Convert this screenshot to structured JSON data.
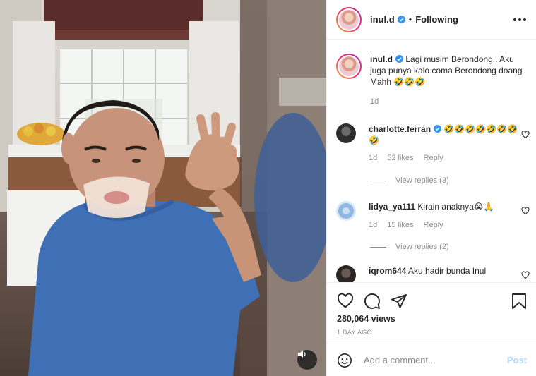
{
  "media": {
    "type": "video",
    "mute_icon": "speaker-icon"
  },
  "header": {
    "username": "inul.d",
    "separator": "•",
    "follow_state": "Following",
    "more_icon": "more-dots-icon"
  },
  "caption": {
    "username": "inul.d",
    "text": "Lagi musim Berondong.. Aku juga punya kalo coma Berondong doang Mahh 🤣🤣🤣",
    "time": "1d"
  },
  "comments": [
    {
      "username": "charlotte.ferran",
      "verified": true,
      "text": "🤣🤣🤣🤣🤣🤣🤣🤣",
      "time": "1d",
      "likes": "52 likes",
      "reply_label": "Reply",
      "view_replies": "View replies (3)"
    },
    {
      "username": "lidya_ya111",
      "verified": false,
      "text": "Kirain anaknya😭🙏",
      "time": "1d",
      "likes": "15 likes",
      "reply_label": "Reply",
      "view_replies": "View replies (2)"
    },
    {
      "username": "iqrom644",
      "verified": false,
      "text": "Aku hadir bunda Inul",
      "time": "",
      "likes": "",
      "reply_label": "",
      "view_replies": ""
    }
  ],
  "actions": {
    "like_icon": "heart-icon",
    "comment_icon": "comment-bubble-icon",
    "share_icon": "paper-plane-icon",
    "save_icon": "bookmark-icon",
    "views": "280,064 views",
    "time_ago": "1 DAY AGO"
  },
  "comment_box": {
    "emoji_icon": "smiley-icon",
    "placeholder": "Add a comment...",
    "post_label": "Post"
  },
  "colors": {
    "verified": "#3897f0",
    "post_disabled": "#b3dbff",
    "muted_text": "#8e8e8e",
    "shirt": "#3f6fb5"
  }
}
